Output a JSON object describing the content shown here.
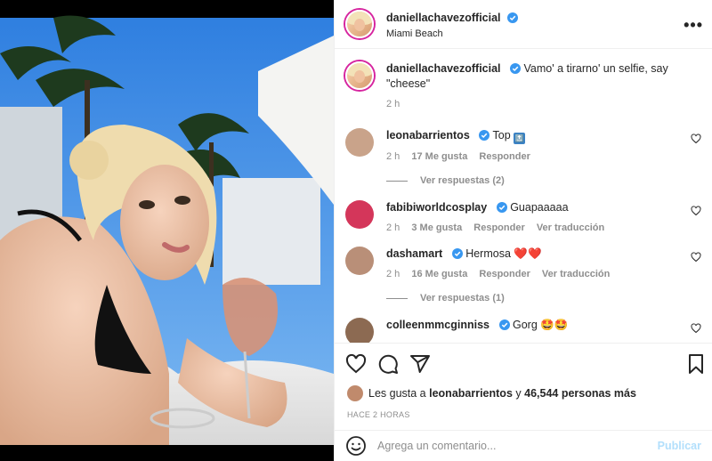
{
  "post": {
    "author": "daniellachavezofficial",
    "location": "Miami Beach",
    "caption_text": "Vamo' a tirarno' un selfie, say \"cheese\"",
    "caption_time": "2 h"
  },
  "comments": [
    {
      "user": "leonabarrientos",
      "text": "Top",
      "emoji": "🔝",
      "time": "2 h",
      "likes": "17 Me gusta",
      "reply": "Responder",
      "translate": "",
      "replies": "Ver respuestas (2)",
      "avatar_color": "#c9a38a"
    },
    {
      "user": "fabibiworldcosplay",
      "text": "Guapaaaaa",
      "emoji": "",
      "time": "2 h",
      "likes": "3 Me gusta",
      "reply": "Responder",
      "translate": "Ver traducción",
      "replies": "",
      "avatar_color": "#d4365a"
    },
    {
      "user": "dashamart",
      "text": "Hermosa",
      "emoji": "❤️❤️",
      "time": "2 h",
      "likes": "16 Me gusta",
      "reply": "Responder",
      "translate": "Ver traducción",
      "replies": "Ver respuestas (1)",
      "avatar_color": "#b98f78"
    },
    {
      "user": "colleenmmcginniss",
      "text": "Gorg",
      "emoji": "🤩🤩",
      "time": "",
      "likes": "",
      "reply": "",
      "translate": "",
      "replies": "",
      "avatar_color": "#8c6a52"
    }
  ],
  "likes": {
    "prefix": "Les gusta a",
    "user": "leonabarrientos",
    "middle": "y",
    "count": "46,544 personas más"
  },
  "timestamp": "HACE 2 HORAS",
  "add_comment": {
    "placeholder": "Agrega un comentario...",
    "publish": "Publicar"
  },
  "icons": {
    "more": "more-options-icon",
    "like": "heart-icon",
    "comment": "comment-icon",
    "share": "share-icon",
    "save": "bookmark-icon",
    "emoji": "emoji-icon",
    "verified": "verified-badge-icon"
  },
  "colors": {
    "verified": "#3897f0",
    "publish_disabled": "#b2dffc",
    "muted": "#8e8e8e"
  }
}
